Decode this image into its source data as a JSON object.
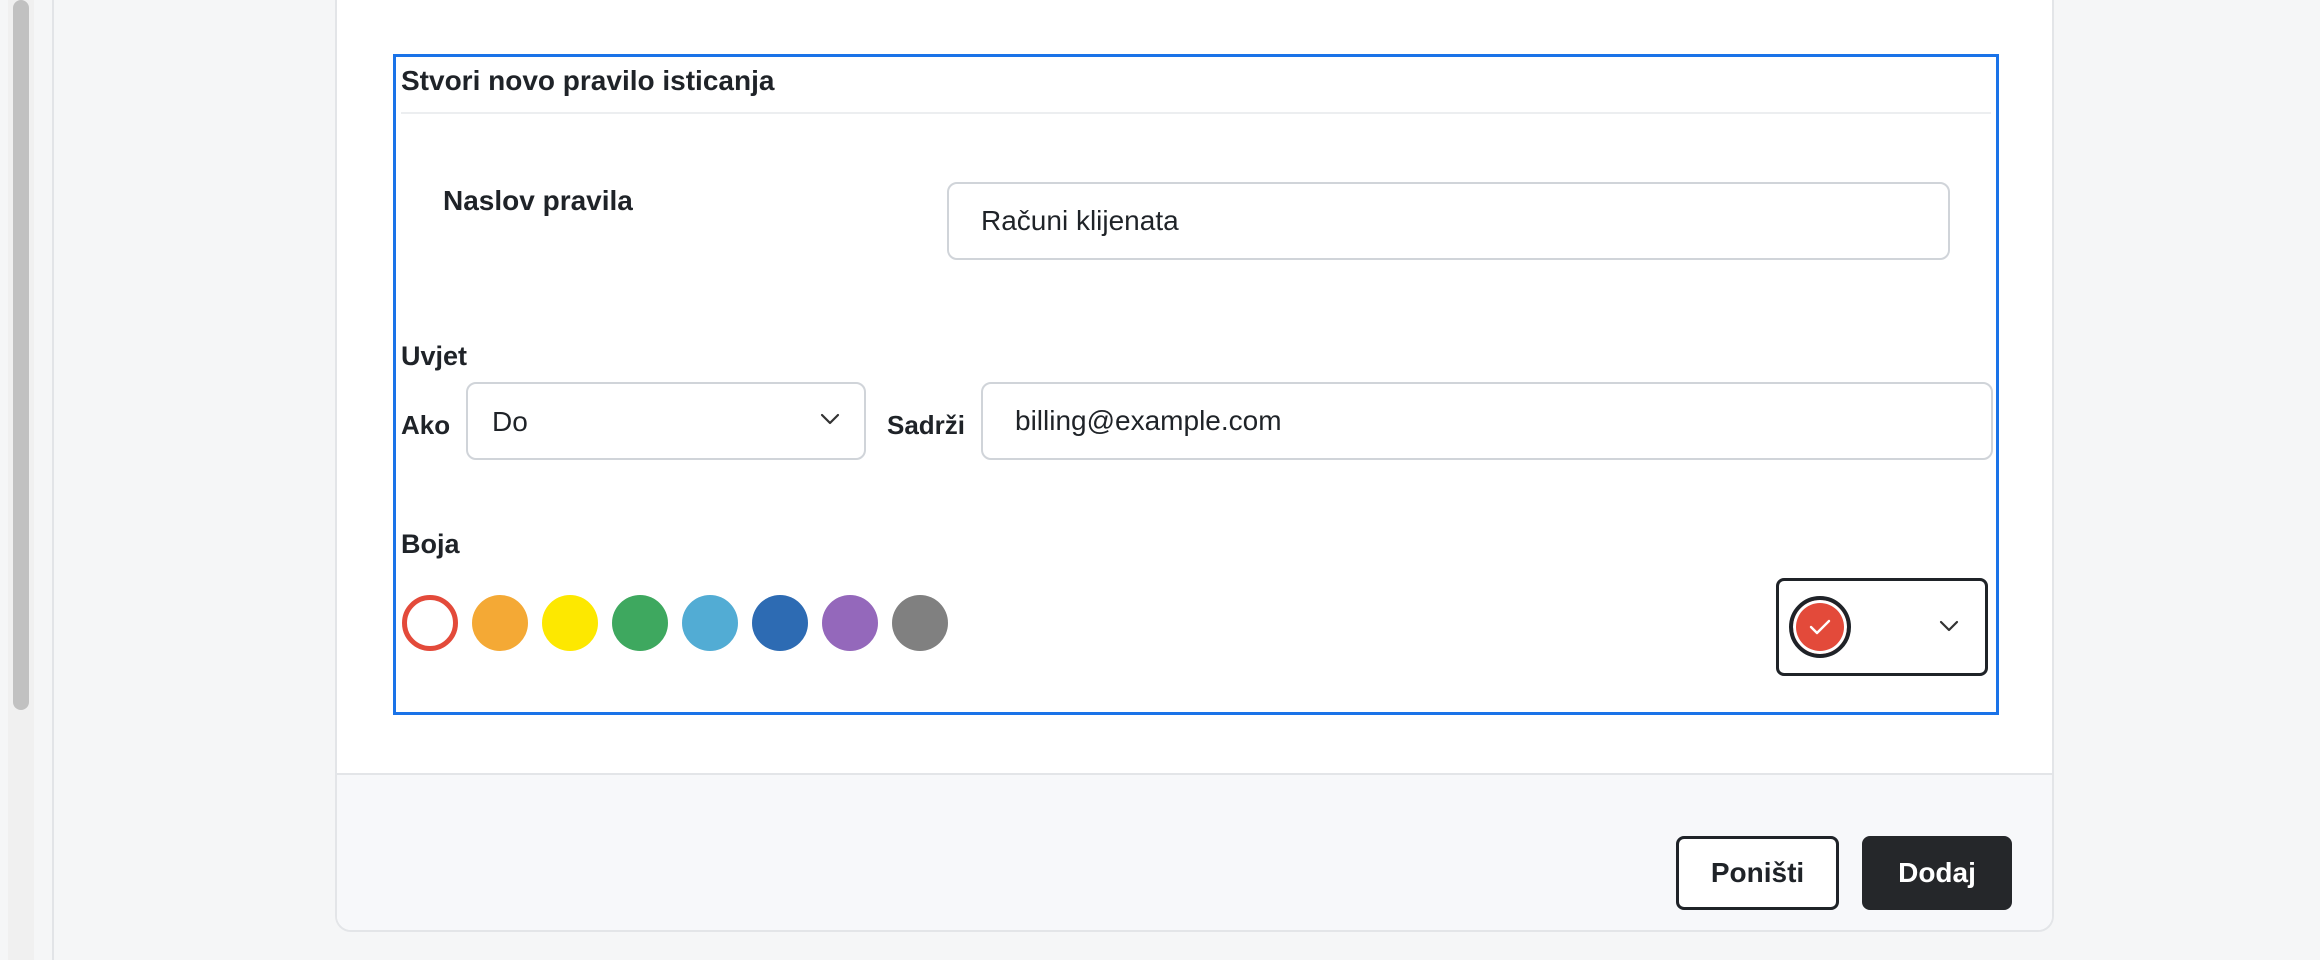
{
  "dialog": {
    "panel_title": "Stvori novo pravilo isticanja",
    "rule_title_label": "Naslov pravila",
    "rule_title_value": "Računi klijenata",
    "condition_label": "Uvjet",
    "if_label": "Ako",
    "field_select_value": "Do",
    "contains_label": "Sadrži",
    "contains_value": "billing@example.com",
    "color_label": "Boja",
    "swatches": [
      {
        "name": "red",
        "hex": "#e34a3a",
        "selected": true
      },
      {
        "name": "orange",
        "hex": "#f4a935"
      },
      {
        "name": "yellow",
        "hex": "#fde800"
      },
      {
        "name": "green",
        "hex": "#3ea85f"
      },
      {
        "name": "light-blue",
        "hex": "#52acd4"
      },
      {
        "name": "blue",
        "hex": "#2d6bb3"
      },
      {
        "name": "purple",
        "hex": "#9468bb"
      },
      {
        "name": "gray",
        "hex": "#808080"
      }
    ],
    "selected_color": "#e34a3a",
    "accent_color": "#1a73e8"
  },
  "footer": {
    "cancel_label": "Poništi",
    "add_label": "Dodaj"
  }
}
